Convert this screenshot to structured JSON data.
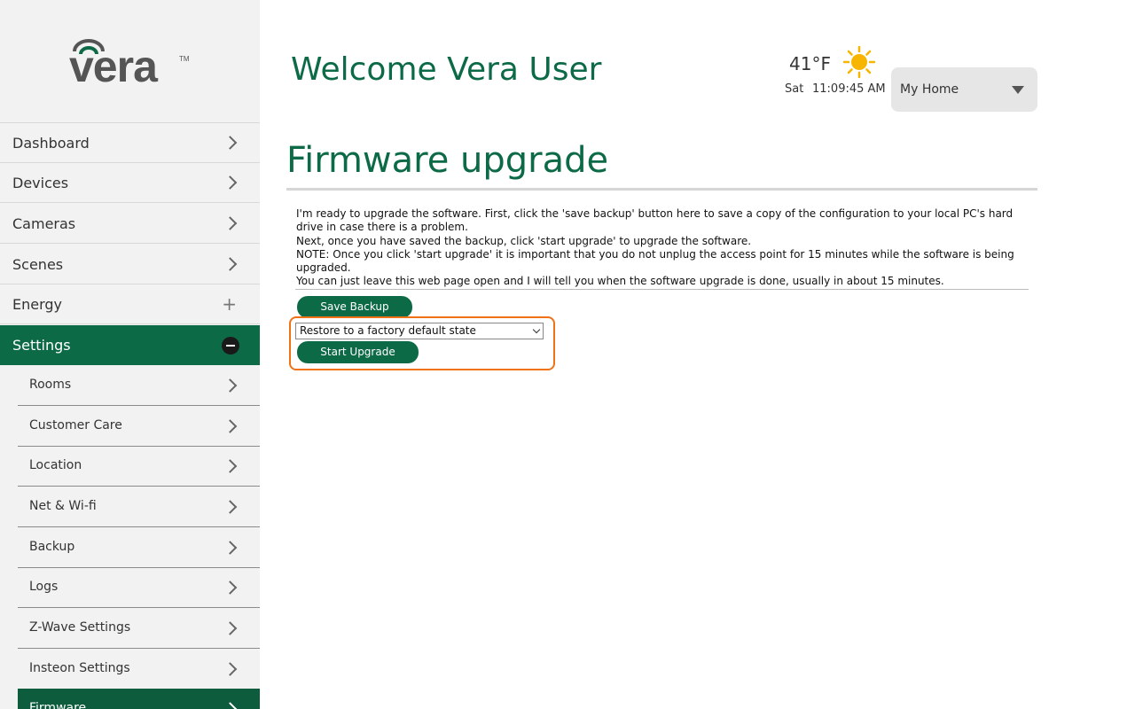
{
  "app": {
    "logo_text": "vera",
    "logo_tm": "TM"
  },
  "header": {
    "welcome": "Welcome Vera User",
    "temperature": "41°F",
    "weather_icon": "sun-icon",
    "day": "Sat",
    "time": "11:09:45 AM",
    "home_selector": "My Home"
  },
  "sidebar": {
    "items": [
      {
        "label": "Dashboard",
        "icon": "chevron-right-icon"
      },
      {
        "label": "Devices",
        "icon": "chevron-right-icon"
      },
      {
        "label": "Cameras",
        "icon": "chevron-right-icon"
      },
      {
        "label": "Scenes",
        "icon": "chevron-right-icon"
      },
      {
        "label": "Energy",
        "icon": "plus-icon"
      },
      {
        "label": "Settings",
        "icon": "minus-circle-icon",
        "active": true
      }
    ],
    "sub_items": [
      {
        "label": "Rooms"
      },
      {
        "label": "Customer Care"
      },
      {
        "label": "Location"
      },
      {
        "label": "Net & Wi-fi"
      },
      {
        "label": "Backup"
      },
      {
        "label": "Logs"
      },
      {
        "label": "Z-Wave Settings"
      },
      {
        "label": "Insteon Settings"
      },
      {
        "label": "Firmware",
        "active": true
      }
    ]
  },
  "main": {
    "title": "Firmware upgrade",
    "instructions": [
      "I'm ready to upgrade the software. First, click the 'save backup' button here to save a copy of the configuration to your local PC's hard drive in case there is a problem.",
      "Next, once you have saved the backup, click 'start upgrade' to upgrade the software.",
      "NOTE: Once you click 'start upgrade' it is important that you do not unplug the access point for 15 minutes while the software is being upgraded.",
      "You can just leave this web page open and I will tell you when the software upgrade is done, usually in about 15 minutes."
    ],
    "save_backup_label": "Save Backup",
    "upgrade_option_selected": "Restore to a factory default state",
    "start_upgrade_label": "Start Upgrade"
  },
  "colors": {
    "brand_green": "#0d6a47",
    "highlight_orange": "#ef7217",
    "sidebar_bg": "#f2f2f2"
  }
}
